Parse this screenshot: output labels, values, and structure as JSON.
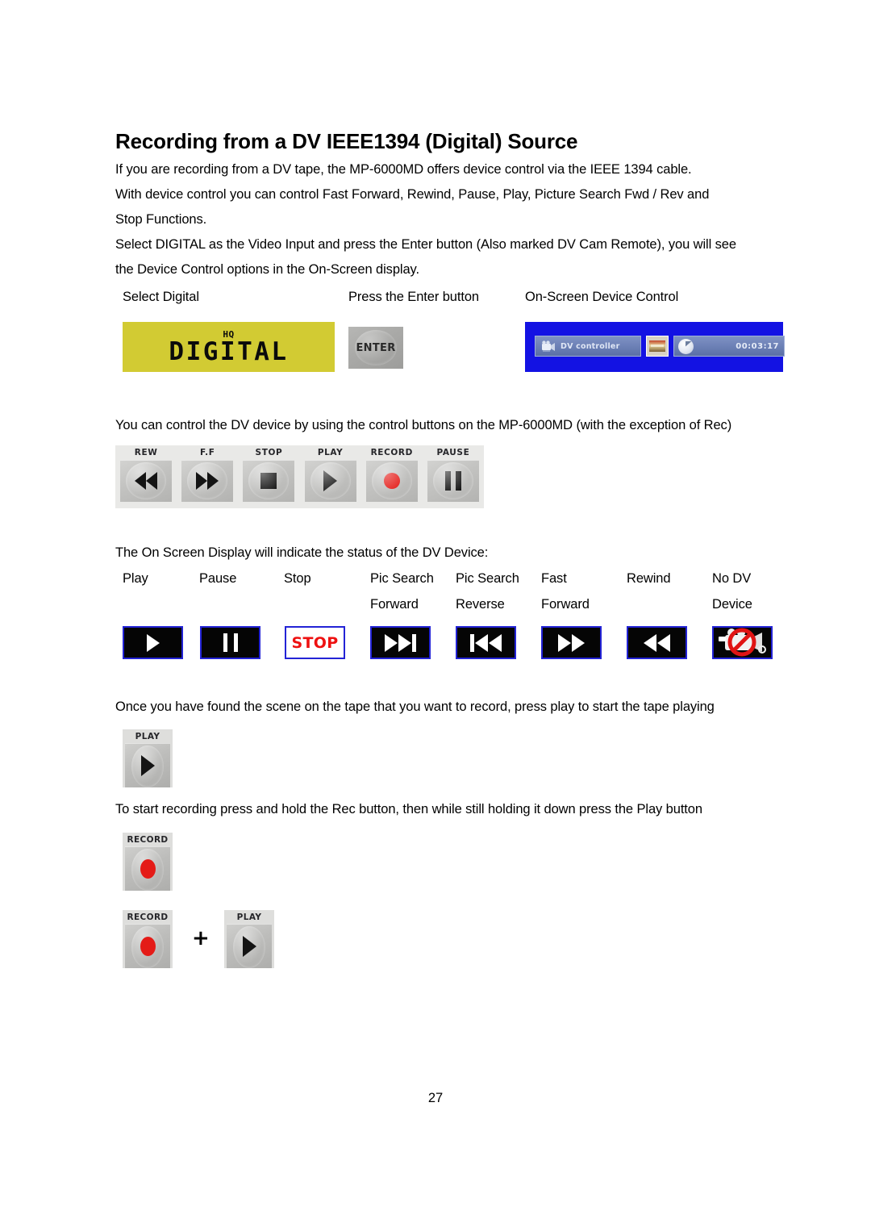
{
  "document": {
    "heading": "Recording from a DV IEEE1394 (Digital) Source",
    "paragraphs": {
      "p1": "If you are recording from a DV tape, the MP-6000MD offers device control via the IEEE 1394 cable.",
      "p2": "With device control you can control Fast Forward, Rewind, Pause, Play, Picture Search Fwd / Rev and",
      "p3": "Stop Functions.",
      "p4": "Select DIGITAL as the Video Input and press the Enter button (Also marked DV Cam Remote), you will see",
      "p5": "the Device Control options in the On-Screen display.",
      "p6": "You can control the DV device by using the control buttons on the MP-6000MD (with the exception of Rec)",
      "p7": "The On Screen Display will indicate the status of the DV Device:",
      "p8": "Once you have found the scene on the tape that you want to record, press play to start the tape playing",
      "p9": "To start recording press and hold the Rec button, then while still holding it down press the Play button"
    },
    "page_number": "27"
  },
  "figure_row": {
    "captions": {
      "select_digital": "Select Digital",
      "press_enter": "Press the Enter button",
      "on_screen_device_control": "On-Screen Device Control"
    },
    "digital_display": {
      "mode": "HQ",
      "label": "DIGITAL",
      "background_color": "#d2cb33"
    },
    "enter_button": {
      "label": "ENTER"
    },
    "osd_device_control": {
      "background_color": "#1312e3",
      "dv_controller_label": "DV controller",
      "timecode": "00:03:17"
    }
  },
  "transport_panel": {
    "buttons": [
      {
        "label": "REW",
        "icon": "rewind-icon"
      },
      {
        "label": "F.F",
        "icon": "fast-forward-icon"
      },
      {
        "label": "STOP",
        "icon": "stop-icon"
      },
      {
        "label": "PLAY",
        "icon": "play-icon"
      },
      {
        "label": "RECORD",
        "icon": "record-icon"
      },
      {
        "label": "PAUSE",
        "icon": "pause-icon"
      }
    ]
  },
  "status_icons": {
    "border_color": "#2323d6",
    "stop_text_color": "#ee1111",
    "stop_word": "STOP",
    "items": [
      {
        "line1": "Play",
        "line2": "",
        "icon": "play-icon"
      },
      {
        "line1": "Pause",
        "line2": "",
        "icon": "pause-icon"
      },
      {
        "line1": "Stop",
        "line2": "",
        "icon": "stop-text-icon"
      },
      {
        "line1": "Pic Search",
        "line2": "Forward",
        "icon": "picture-search-forward-icon"
      },
      {
        "line1": "Pic Search",
        "line2": "Reverse",
        "icon": "picture-search-reverse-icon"
      },
      {
        "line1": "Fast",
        "line2": "Forward",
        "icon": "fast-forward-icon"
      },
      {
        "line1": "Rewind",
        "line2": "",
        "icon": "rewind-icon"
      },
      {
        "line1": "No DV",
        "line2": "Device",
        "icon": "no-dv-device-icon"
      }
    ]
  },
  "play_key": {
    "label": "PLAY"
  },
  "record_key": {
    "label": "RECORD"
  },
  "record_plus_play": {
    "record_label": "RECORD",
    "plus": "+",
    "play_label": "PLAY"
  }
}
